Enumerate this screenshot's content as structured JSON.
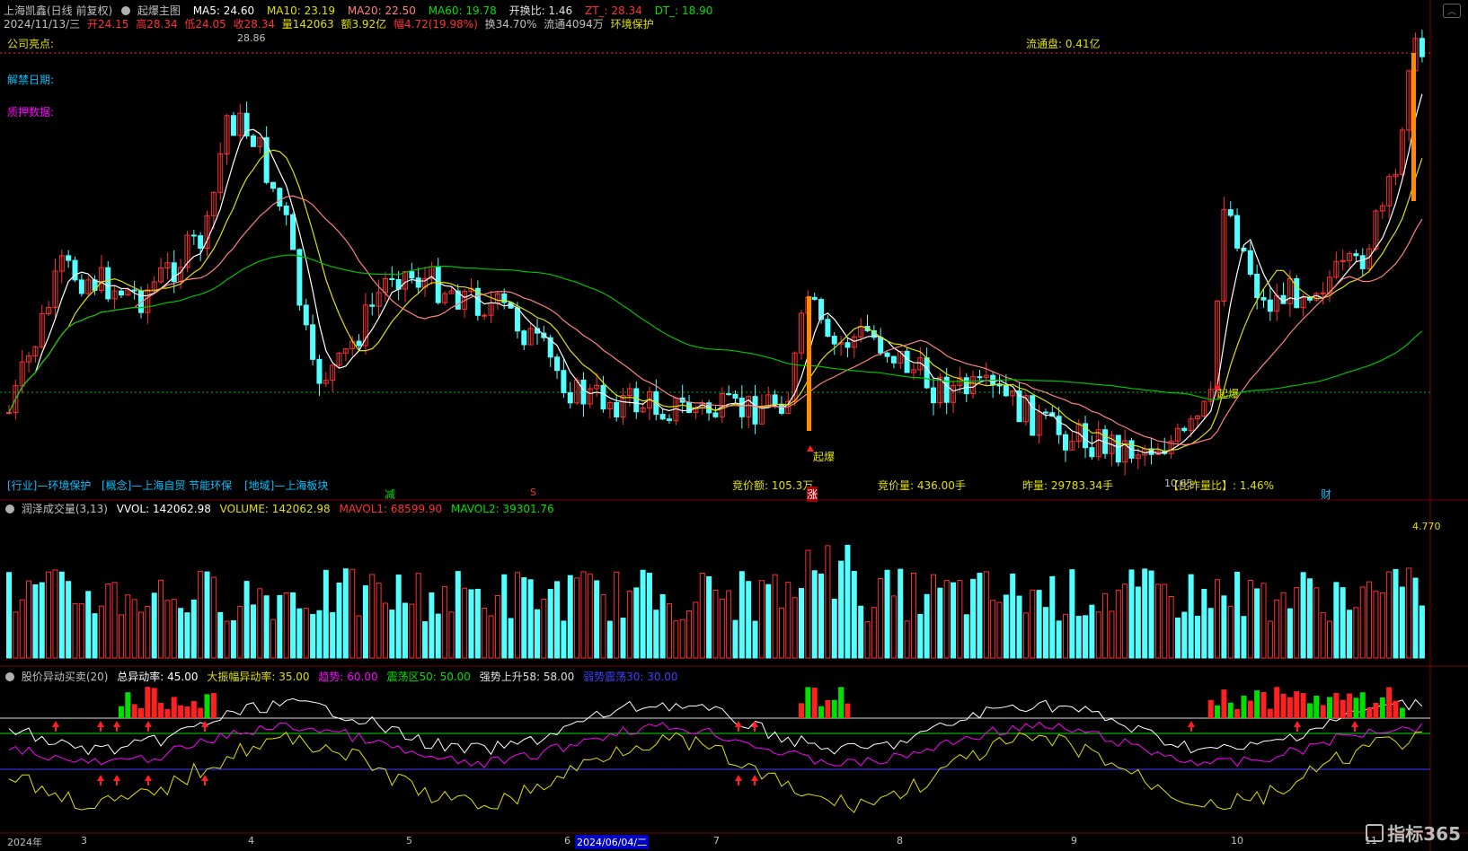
{
  "header": {
    "stock_name": "上海凯鑫(日线 前复权)",
    "indicator_name": "起爆主图",
    "ma5": "MA5: 24.60",
    "ma10": "MA10: 23.19",
    "ma20": "MA20: 22.50",
    "ma60": "MA60: 19.78",
    "switch_ratio": "开换比: 1.46",
    "zt": "ZT_: 28.34",
    "dt": "DT_: 18.90",
    "date": "2024/11/13/三",
    "open": "开24.15",
    "high": "高28.34",
    "low": "低24.05",
    "close": "收28.34",
    "volume": "量142063",
    "amount": "额3.92亿",
    "change": "幅4.72(19.98%)",
    "turnover": "换34.70%",
    "float_shares": "流通4094万",
    "sector": "环境保护"
  },
  "main_panel": {
    "highlights_label": "公司亮点:",
    "unlock_label": "解禁日期:",
    "pledge_label": "质押数据:",
    "float_cap": "流通盘: 0.41亿",
    "peak_price": "28.86",
    "industry": "[行业]—环境保护",
    "concept": "[概念]—上海自贸 节能环保",
    "region": "[地域]—上海板块",
    "bid_amount": "竞价额: 105.3万",
    "bid_price": "竞价量: 436.00手",
    "prev_volume": "昨量: 29783.34手",
    "prev_ratio": "【比昨量比】: 1.46%",
    "low_mark": "10.65",
    "signal_1": "起爆",
    "signal_2": "起爆",
    "event_jian": "减",
    "event_s": "S",
    "event_zhang": "涨",
    "event_cai": "财"
  },
  "volume_panel": {
    "title": "润泽成交量(3,13)",
    "vvol": "VVOL: 142062.98",
    "volume": "VOLUME: 142062.98",
    "mavol1": "MAVOL1: 68599.90",
    "mavol2": "MAVOL2: 39301.76",
    "axis_value": "4.770"
  },
  "signal_panel": {
    "title": "股价异动买卖(20)",
    "total_rate": "总异动率: 45.00",
    "big_amp_rate": "大振幅异动率: 35.00",
    "trend": "趋势: 60.00",
    "range_zone": "震荡区50: 50.00",
    "strong_rise": "强势上升58: 58.00",
    "weak_range": "弱势震荡30: 30.00"
  },
  "x_axis": {
    "labels": [
      "2024年",
      "3",
      "4",
      "5",
      "6",
      "2024/06/04/二",
      "7",
      "8",
      "9",
      "10",
      "11"
    ]
  },
  "watermark": "指标365",
  "colors": {
    "up": "#ff3030",
    "down": "#54ffff",
    "ma5": "#ffffff",
    "ma10": "#e0e000",
    "ma20": "#ff8080",
    "ma60": "#00c000",
    "panel_border": "#7a0000"
  }
}
